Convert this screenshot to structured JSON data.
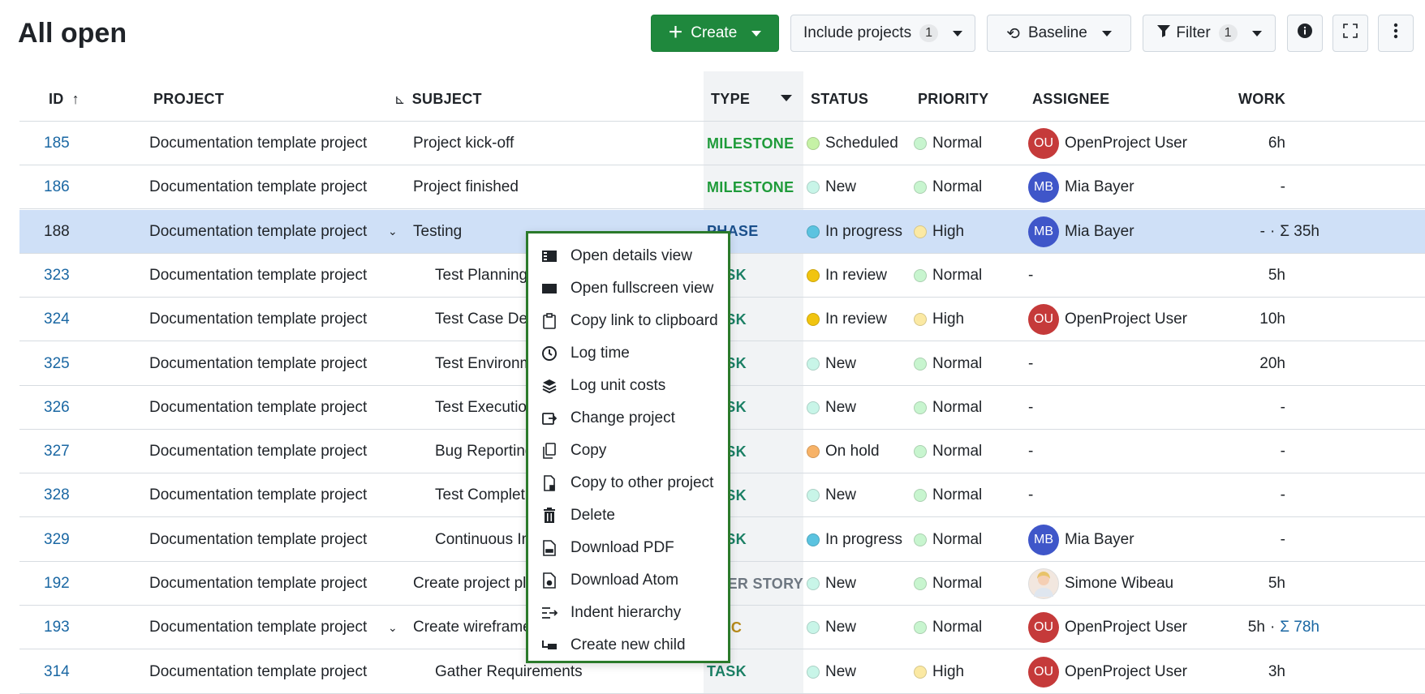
{
  "title": "All open",
  "toolbar": {
    "create": "Create",
    "include_projects": "Include projects",
    "include_projects_count": "1",
    "baseline": "Baseline",
    "filter": "Filter",
    "filter_count": "1"
  },
  "columns": {
    "id": "ID",
    "project": "PROJECT",
    "subject": "SUBJECT",
    "type": "TYPE",
    "status": "STATUS",
    "priority": "PRIORITY",
    "assignee": "ASSIGNEE",
    "work": "WORK"
  },
  "colors": {
    "milestone": "#1f9b3a",
    "phase": "#1a4f8b",
    "task": "#1a7f64",
    "user_story": "#6e7781",
    "epic": "#b78a1a",
    "create_button": "#1f883d",
    "selected_row": "#cfe0f7",
    "menu_border": "#2b7a2b"
  },
  "rows": [
    {
      "id": "185",
      "project": "Documentation template project",
      "subject": "Project kick-off",
      "type": "MILESTONE",
      "type_color": "#1f9b3a",
      "status": "Scheduled",
      "status_color": "#c6f2a6",
      "priority": "Normal",
      "priority_color": "#c8f5cf",
      "assignee": "OpenProject User",
      "avatar": "OU",
      "avatar_color": "#c53a3a",
      "work": "6h",
      "sum": ""
    },
    {
      "id": "186",
      "project": "Documentation template project",
      "subject": "Project finished",
      "type": "MILESTONE",
      "type_color": "#1f9b3a",
      "status": "New",
      "status_color": "#c8f5e8",
      "priority": "Normal",
      "priority_color": "#c8f5cf",
      "assignee": "Mia Bayer",
      "avatar": "MB",
      "avatar_color": "#3f56c9",
      "work": "-",
      "sum": ""
    },
    {
      "id": "188",
      "project": "Documentation template project",
      "subject": "Testing",
      "type": "PHASE",
      "type_color": "#1a4f8b",
      "status": "In progress",
      "status_color": "#5bc3e0",
      "priority": "High",
      "priority_color": "#fbe9a3",
      "assignee": "Mia Bayer",
      "avatar": "MB",
      "avatar_color": "#3f56c9",
      "work": "-",
      "sum": "Σ 35h",
      "selected": true,
      "toggle": "⌄"
    },
    {
      "id": "323",
      "project": "Documentation template project",
      "subject": "Test Planning",
      "type": "TASK",
      "type_color": "#1a7f64",
      "status": "In review",
      "status_color": "#f1c40f",
      "priority": "Normal",
      "priority_color": "#c8f5cf",
      "assignee": "-",
      "avatar": "",
      "avatar_color": "",
      "work": "5h",
      "sum": "",
      "child": true
    },
    {
      "id": "324",
      "project": "Documentation template project",
      "subject": "Test Case Design",
      "type": "TASK",
      "type_color": "#1a7f64",
      "status": "In review",
      "status_color": "#f1c40f",
      "priority": "High",
      "priority_color": "#fbe9a3",
      "assignee": "OpenProject User",
      "avatar": "OU",
      "avatar_color": "#c53a3a",
      "work": "10h",
      "sum": "",
      "child": true
    },
    {
      "id": "325",
      "project": "Documentation template project",
      "subject": "Test Environment",
      "type": "TASK",
      "type_color": "#1a7f64",
      "status": "New",
      "status_color": "#c8f5e8",
      "priority": "Normal",
      "priority_color": "#c8f5cf",
      "assignee": "-",
      "avatar": "",
      "avatar_color": "",
      "work": "20h",
      "sum": "",
      "child": true
    },
    {
      "id": "326",
      "project": "Documentation template project",
      "subject": "Test Execution",
      "type": "TASK",
      "type_color": "#1a7f64",
      "status": "New",
      "status_color": "#c8f5e8",
      "priority": "Normal",
      "priority_color": "#c8f5cf",
      "assignee": "-",
      "avatar": "",
      "avatar_color": "",
      "work": "-",
      "sum": "",
      "child": true
    },
    {
      "id": "327",
      "project": "Documentation template project",
      "subject": "Bug Reporting",
      "type": "TASK",
      "type_color": "#1a7f64",
      "status": "On hold",
      "status_color": "#f7b267",
      "priority": "Normal",
      "priority_color": "#c8f5cf",
      "assignee": "-",
      "avatar": "",
      "avatar_color": "",
      "work": "-",
      "sum": "",
      "child": true
    },
    {
      "id": "328",
      "project": "Documentation template project",
      "subject": "Test Completion",
      "type": "TASK",
      "type_color": "#1a7f64",
      "status": "New",
      "status_color": "#c8f5e8",
      "priority": "Normal",
      "priority_color": "#c8f5cf",
      "assignee": "-",
      "avatar": "",
      "avatar_color": "",
      "work": "-",
      "sum": "",
      "child": true
    },
    {
      "id": "329",
      "project": "Documentation template project",
      "subject": "Continuous Improvement",
      "type": "TASK",
      "type_color": "#1a7f64",
      "status": "In progress",
      "status_color": "#5bc3e0",
      "priority": "Normal",
      "priority_color": "#c8f5cf",
      "assignee": "Mia Bayer",
      "avatar": "MB",
      "avatar_color": "#3f56c9",
      "work": "-",
      "sum": "",
      "child": true
    },
    {
      "id": "192",
      "project": "Documentation template project",
      "subject": "Create project plan",
      "type": "USER STORY",
      "type_color": "#6e7781",
      "status": "New",
      "status_color": "#c8f5e8",
      "priority": "Normal",
      "priority_color": "#c8f5cf",
      "assignee": "Simone Wibeau",
      "avatar": "",
      "avatar_color": "photo",
      "work": "5h",
      "sum": ""
    },
    {
      "id": "193",
      "project": "Documentation template project",
      "subject": "Create wireframes",
      "type": "EPIC",
      "type_color": "#b78a1a",
      "status": "New",
      "status_color": "#c8f5e8",
      "priority": "Normal",
      "priority_color": "#c8f5cf",
      "assignee": "OpenProject User",
      "avatar": "OU",
      "avatar_color": "#c53a3a",
      "work": "5h",
      "sum": "Σ 78h",
      "toggle": "⌄"
    },
    {
      "id": "314",
      "project": "Documentation template project",
      "subject": "Gather Requirements",
      "type": "TASK",
      "type_color": "#1a7f64",
      "status": "New",
      "status_color": "#c8f5e8",
      "priority": "High",
      "priority_color": "#fbe9a3",
      "assignee": "OpenProject User",
      "avatar": "OU",
      "avatar_color": "#c53a3a",
      "work": "3h",
      "sum": "",
      "child": true
    }
  ],
  "context_menu": [
    {
      "label": "Open details view",
      "icon": "details-view-icon"
    },
    {
      "label": "Open fullscreen view",
      "icon": "fullscreen-view-icon"
    },
    {
      "label": "Copy link to clipboard",
      "icon": "clipboard-icon"
    },
    {
      "label": "Log time",
      "icon": "clock-icon"
    },
    {
      "label": "Log unit costs",
      "icon": "layers-icon"
    },
    {
      "label": "Change project",
      "icon": "move-icon"
    },
    {
      "label": "Copy",
      "icon": "copy-icon"
    },
    {
      "label": "Copy to other project",
      "icon": "copy-project-icon"
    },
    {
      "label": "Delete",
      "icon": "trash-icon"
    },
    {
      "label": "Download PDF",
      "icon": "pdf-icon"
    },
    {
      "label": "Download Atom",
      "icon": "atom-icon"
    },
    {
      "label": "Indent hierarchy",
      "icon": "indent-icon"
    },
    {
      "label": "Create new child",
      "icon": "child-icon"
    }
  ]
}
